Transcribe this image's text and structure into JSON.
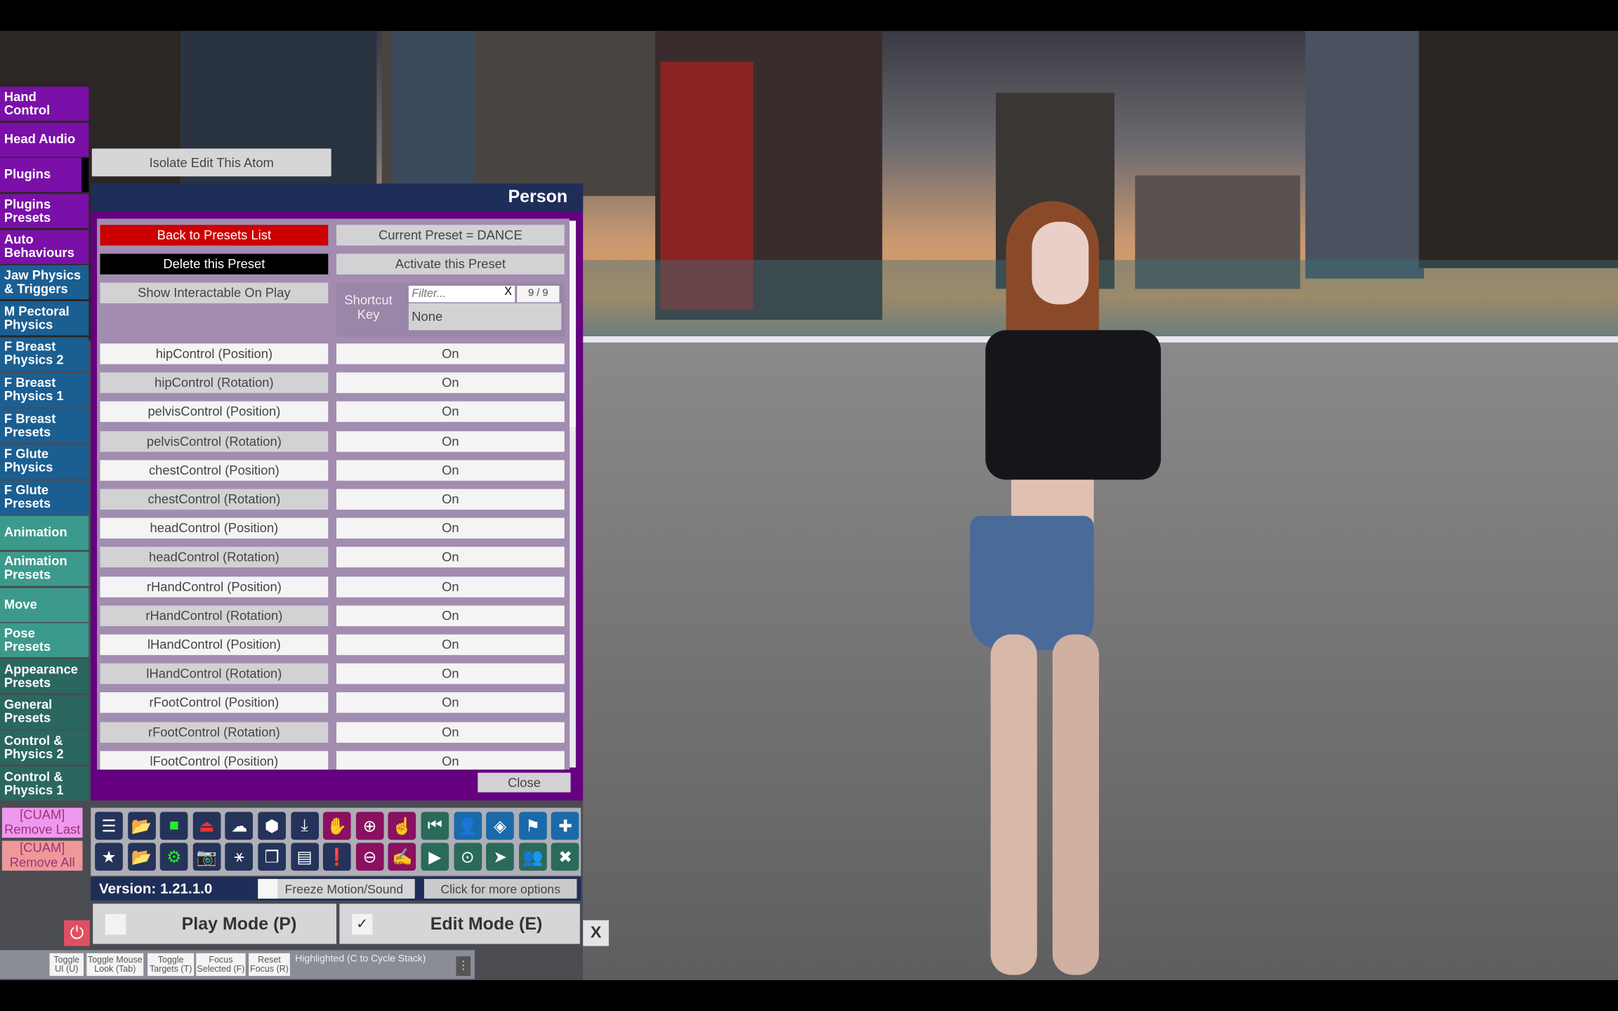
{
  "sidebar": {
    "items": [
      {
        "label": "Hand Control",
        "color": "#7a10a8"
      },
      {
        "label": "Head Audio",
        "color": "#7a10a8"
      },
      {
        "label": "Plugins",
        "color": "#7a10a8"
      },
      {
        "label": "Plugins Presets",
        "color": "#7a10a8"
      },
      {
        "label": "Auto Behaviours",
        "color": "#7a10a8"
      },
      {
        "label": "Jaw Physics & Triggers",
        "color": "#1b5e92"
      },
      {
        "label": "M Pectoral Physics",
        "color": "#1b5e92"
      },
      {
        "label": "F Breast Physics 2",
        "color": "#1b5e92"
      },
      {
        "label": "F Breast Physics 1",
        "color": "#1b5e92"
      },
      {
        "label": "F Breast Presets",
        "color": "#1b5e92"
      },
      {
        "label": "F Glute Physics",
        "color": "#1b5e92"
      },
      {
        "label": "F Glute Presets",
        "color": "#1b5e92"
      },
      {
        "label": "Animation",
        "color": "#3c9a8c"
      },
      {
        "label": "Animation Presets",
        "color": "#3c9a8c"
      },
      {
        "label": "Move",
        "color": "#3c9a8c"
      },
      {
        "label": "Pose Presets",
        "color": "#3c9a8c"
      },
      {
        "label": "Appearance Presets",
        "color": "#2a675f"
      },
      {
        "label": "General Presets",
        "color": "#2a675f"
      },
      {
        "label": "Control & Physics 2",
        "color": "#2a675f"
      },
      {
        "label": "Control & Physics 1",
        "color": "#2a675f"
      }
    ],
    "cuam_remove_last": "[CUAM] Remove Last",
    "cuam_remove_all": "[CUAM] Remove All"
  },
  "isolate_button": "Isolate Edit This Atom",
  "panel": {
    "title": "Person",
    "back_button": "Back to Presets List",
    "current_preset": "Current Preset = DANCE",
    "delete_button": "Delete this Preset",
    "activate_button": "Activate this Preset",
    "show_interactable_button": "Show Interactable On Play",
    "shortcut_label": "Shortcut Key",
    "filter_placeholder": "Filter...",
    "filter_clear": "X",
    "filter_count": "9 / 9",
    "shortcut_value": "None",
    "close_button": "Close",
    "rows": [
      {
        "name": "hipControl (Position)",
        "value": "On"
      },
      {
        "name": "hipControl (Rotation)",
        "value": "On"
      },
      {
        "name": "pelvisControl (Position)",
        "value": "On"
      },
      {
        "name": "pelvisControl (Rotation)",
        "value": "On"
      },
      {
        "name": "chestControl (Position)",
        "value": "On"
      },
      {
        "name": "chestControl (Rotation)",
        "value": "On"
      },
      {
        "name": "headControl (Position)",
        "value": "On"
      },
      {
        "name": "headControl (Rotation)",
        "value": "On"
      },
      {
        "name": "rHandControl (Position)",
        "value": "On"
      },
      {
        "name": "rHandControl (Rotation)",
        "value": "On"
      },
      {
        "name": "lHandControl (Position)",
        "value": "On"
      },
      {
        "name": "lHandControl (Rotation)",
        "value": "On"
      },
      {
        "name": "rFootControl (Position)",
        "value": "On"
      },
      {
        "name": "rFootControl (Rotation)",
        "value": "On"
      },
      {
        "name": "lFootControl (Position)",
        "value": "On"
      }
    ]
  },
  "toolbar": {
    "row1": [
      {
        "icon": "menu-icon",
        "glyph": "☰",
        "bg": "#25335a",
        "fg": "#fff"
      },
      {
        "icon": "open-scene-icon",
        "glyph": "📂",
        "bg": "#25335a",
        "fg": "#3f3"
      },
      {
        "icon": "folder-icon",
        "glyph": "■",
        "bg": "#25335a",
        "fg": "#2e2"
      },
      {
        "icon": "close-scene-icon",
        "glyph": "⏏",
        "bg": "#25335a",
        "fg": "#e33"
      },
      {
        "icon": "cloud-download-icon",
        "glyph": "☁",
        "bg": "#25335a",
        "fg": "#fff"
      },
      {
        "icon": "cube-icon",
        "glyph": "⬢",
        "bg": "#25335a",
        "fg": "#fff"
      },
      {
        "icon": "inbox-download-icon",
        "glyph": "⤓",
        "bg": "#25335a",
        "fg": "#fff"
      },
      {
        "icon": "hand-icon",
        "glyph": "✋",
        "bg": "#8a1060",
        "fg": "#fff"
      },
      {
        "icon": "add-person-icon",
        "glyph": "⊕",
        "bg": "#8a1060",
        "fg": "#fff"
      },
      {
        "icon": "touch-icon",
        "glyph": "☝",
        "bg": "#8a1060",
        "fg": "#fff"
      },
      {
        "icon": "skip-back-icon",
        "glyph": "⏮",
        "bg": "#2a6a5a",
        "fg": "#fff"
      },
      {
        "icon": "person-icon",
        "glyph": "👤",
        "bg": "#1a6aaa",
        "fg": "#fff"
      },
      {
        "icon": "unity-icon",
        "glyph": "◈",
        "bg": "#1a6aaa",
        "fg": "#fff"
      },
      {
        "icon": "flag-icon",
        "glyph": "⚑",
        "bg": "#1a6aaa",
        "fg": "#fff"
      },
      {
        "icon": "plus-icon",
        "glyph": "✚",
        "bg": "#1a6aaa",
        "fg": "#fff"
      }
    ],
    "row2": [
      {
        "icon": "star-icon",
        "glyph": "★",
        "bg": "#25335a",
        "fg": "#fff"
      },
      {
        "icon": "open-folder-icon",
        "glyph": "📂",
        "bg": "#25335a",
        "fg": "#dcb"
      },
      {
        "icon": "folder-gear-icon",
        "glyph": "⚙",
        "bg": "#25335a",
        "fg": "#2e2"
      },
      {
        "icon": "camera-icon",
        "glyph": "📷",
        "bg": "#25335a",
        "fg": "#fff"
      },
      {
        "icon": "nodes-icon",
        "glyph": "⚹",
        "bg": "#25335a",
        "fg": "#fff"
      },
      {
        "icon": "box-icon",
        "glyph": "❒",
        "bg": "#25335a",
        "fg": "#fff"
      },
      {
        "icon": "document-icon",
        "glyph": "▤",
        "bg": "#25335a",
        "fg": "#fff"
      },
      {
        "icon": "alert-icon",
        "glyph": "❗",
        "bg": "#25335a",
        "fg": "#fff"
      },
      {
        "icon": "remove-person-icon",
        "glyph": "⊖",
        "bg": "#8a1060",
        "fg": "#fff"
      },
      {
        "icon": "grab-icon",
        "glyph": "✍",
        "bg": "#8a1060",
        "fg": "#fff"
      },
      {
        "icon": "play-icon",
        "glyph": "▶",
        "bg": "#2a6a5a",
        "fg": "#fff"
      },
      {
        "icon": "target-icon",
        "glyph": "⊙",
        "bg": "#2a6a5a",
        "fg": "#fff"
      },
      {
        "icon": "pointer-icon",
        "glyph": "➤",
        "bg": "#2a6a5a",
        "fg": "#fff"
      },
      {
        "icon": "people-icon",
        "glyph": "👥",
        "bg": "#2a6a5a",
        "fg": "#fff"
      },
      {
        "icon": "tools-icon",
        "glyph": "✖",
        "bg": "#2a6a5a",
        "fg": "#fff"
      }
    ]
  },
  "status": {
    "version": "Version: 1.21.1.0",
    "freeze_label": "Freeze Motion/Sound",
    "more_options": "Click for more options"
  },
  "modes": {
    "play": "Play Mode (P)",
    "edit": "Edit Mode (E)",
    "edit_checked": "✓",
    "close": "X"
  },
  "footer": {
    "buttons": [
      "Toggle UI (U)",
      "Toggle Mouse Look (Tab)",
      "Toggle Targets (T)",
      "Focus Selected (F)",
      "Reset Focus (R)"
    ],
    "highlighted": "Highlighted (C to Cycle Stack)",
    "more": "⋮"
  }
}
